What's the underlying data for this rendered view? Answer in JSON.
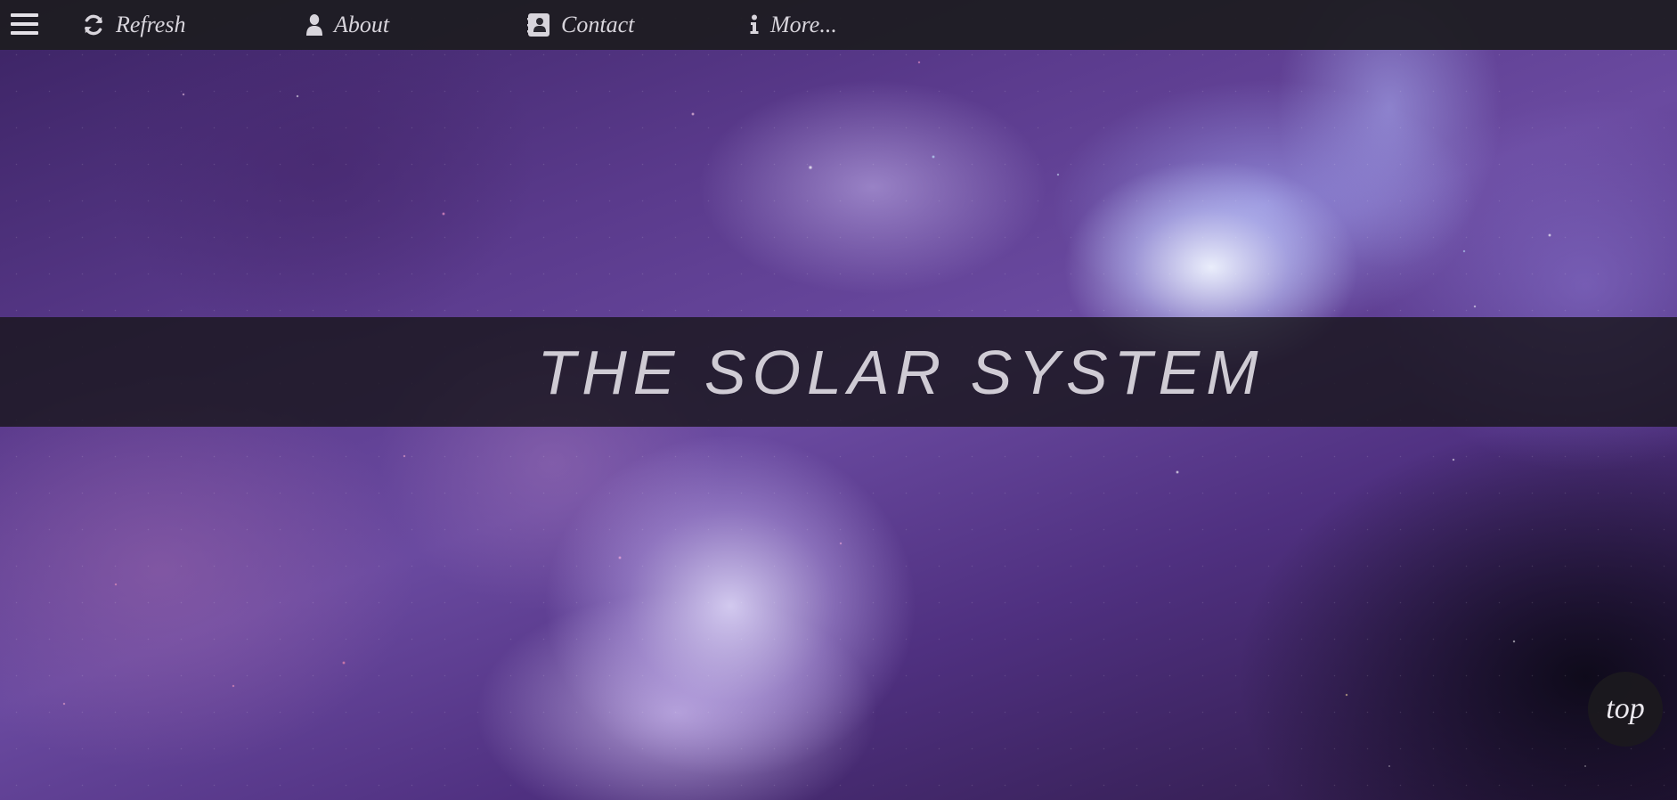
{
  "nav": {
    "menu_icon": "hamburger-menu-icon",
    "items": [
      {
        "label": "Refresh",
        "icon": "refresh-icon"
      },
      {
        "label": "About",
        "icon": "user-icon"
      },
      {
        "label": "Contact",
        "icon": "address-book-icon"
      },
      {
        "label": "More...",
        "icon": "info-icon"
      }
    ]
  },
  "hero": {
    "title": "THE SOLAR SYSTEM",
    "background": "purple-nebula-space-image"
  },
  "back_to_top": {
    "label": "top"
  },
  "colors": {
    "topbar": "#1e1c22",
    "nav_text": "#d8d5dc",
    "title_band": "#18161c",
    "title_text": "#cfcbd4",
    "nebula_primary": "#5a3a8c"
  }
}
